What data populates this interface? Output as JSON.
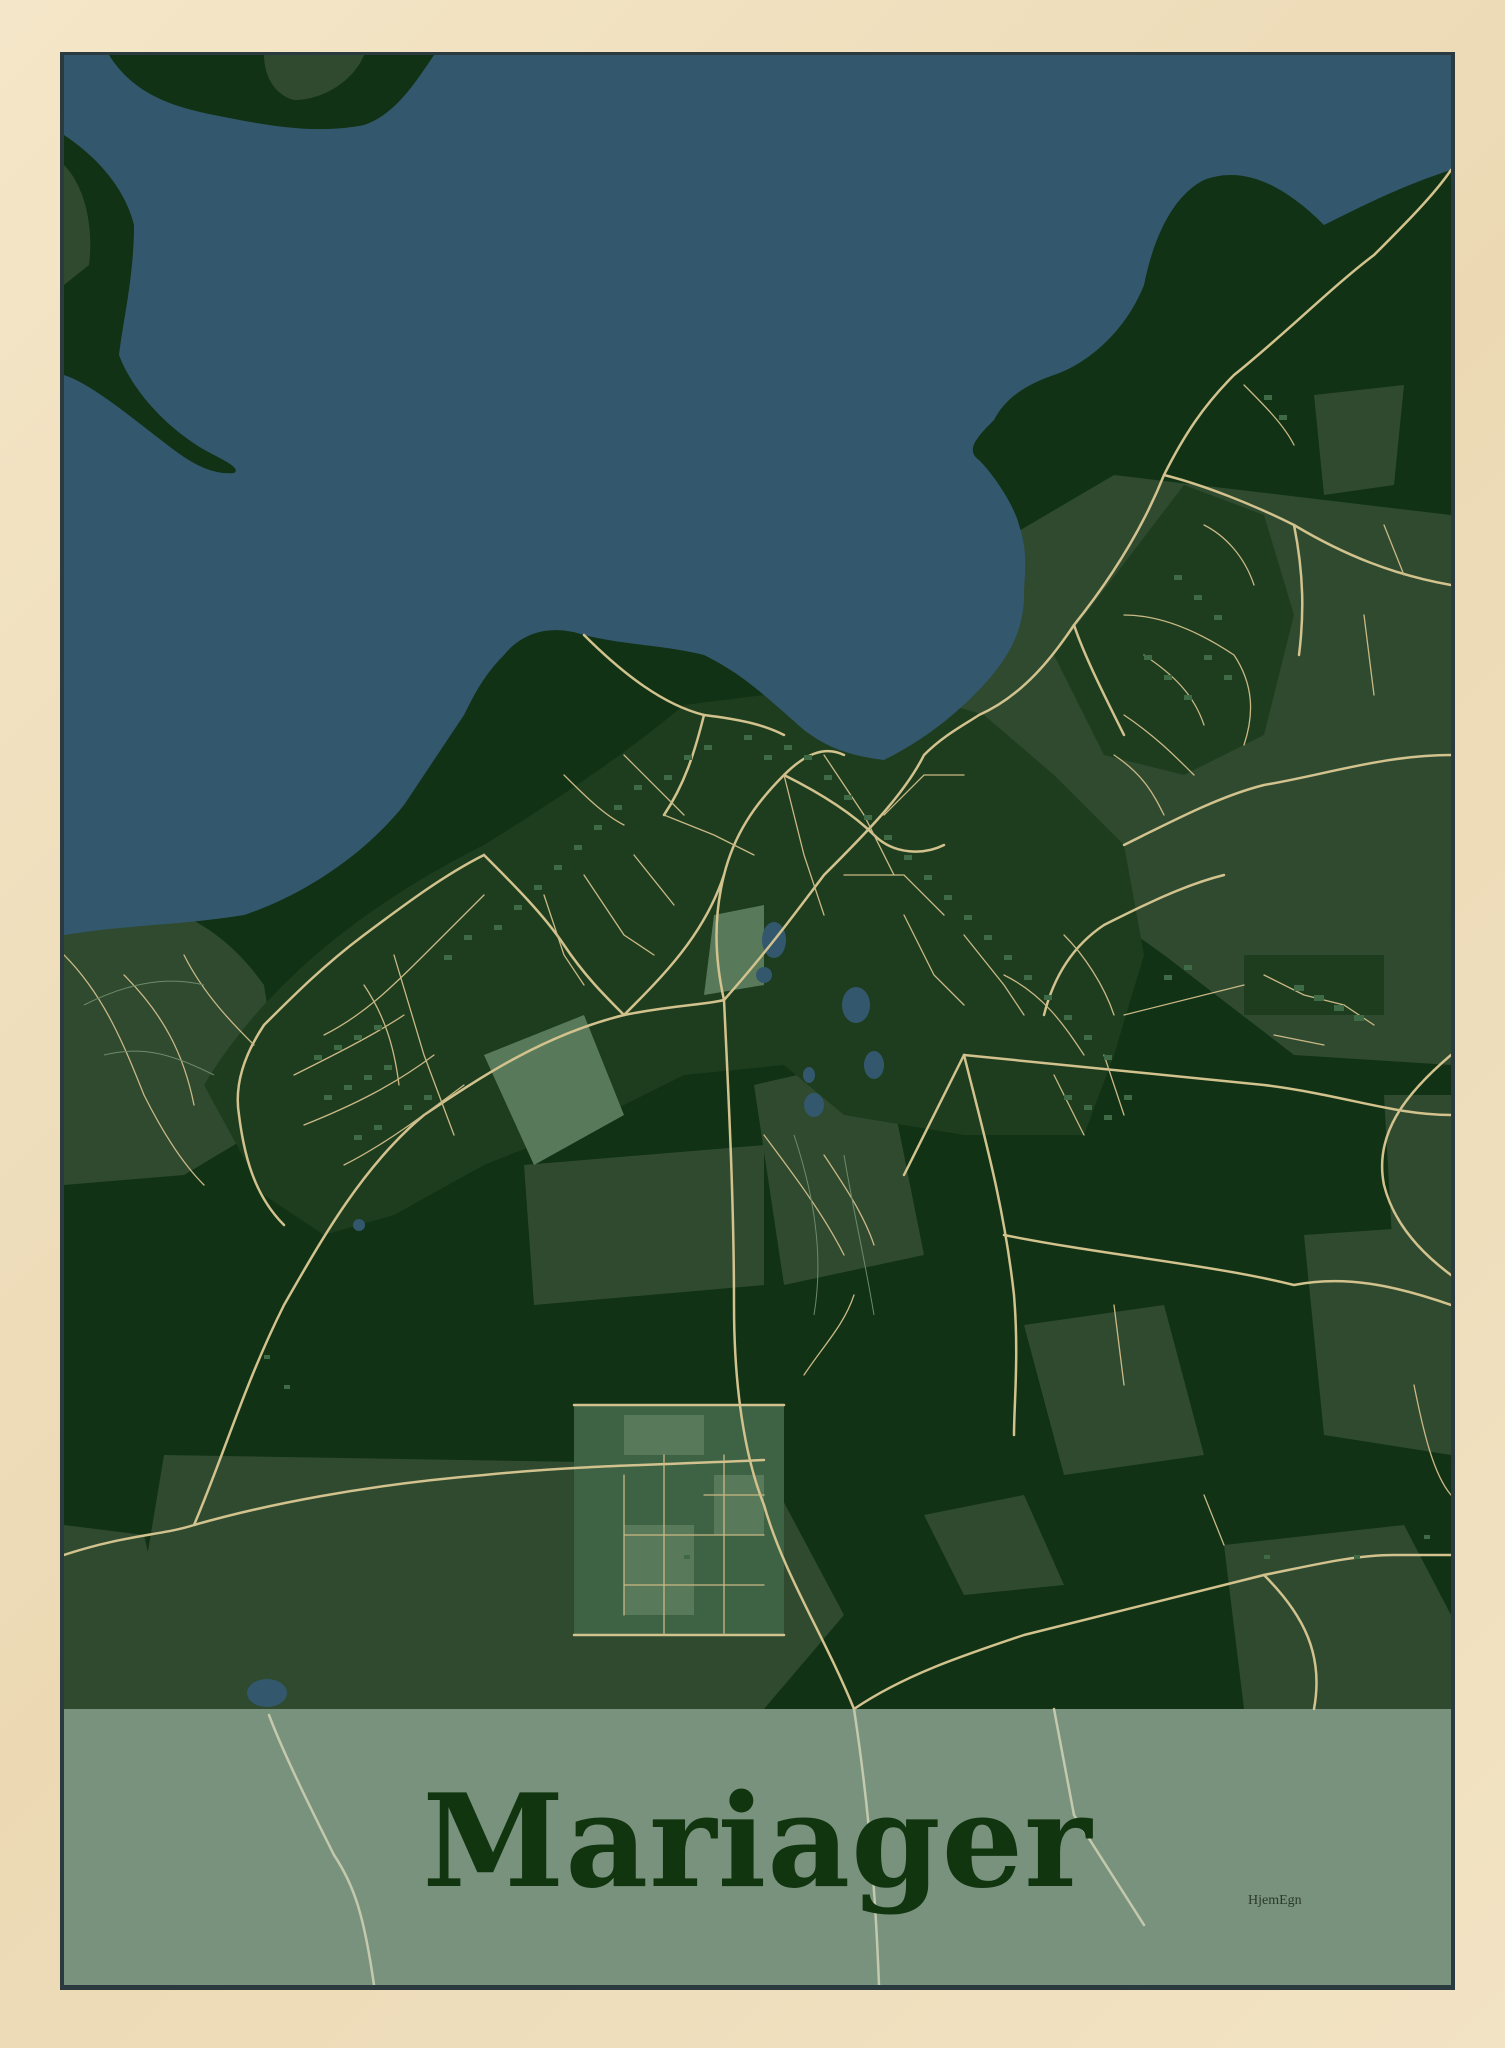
{
  "poster": {
    "title": "Mariager",
    "brand": "HjemEgn"
  },
  "colors": {
    "frame": "#efe0c0",
    "water": "#33586e",
    "land_dark": "#113214",
    "land_mid": "#2f4a2f",
    "land_light": "#5c7f5c",
    "roads": "#d2c28e",
    "title_band": "#b9cdbe",
    "title_text": "#11350f"
  }
}
